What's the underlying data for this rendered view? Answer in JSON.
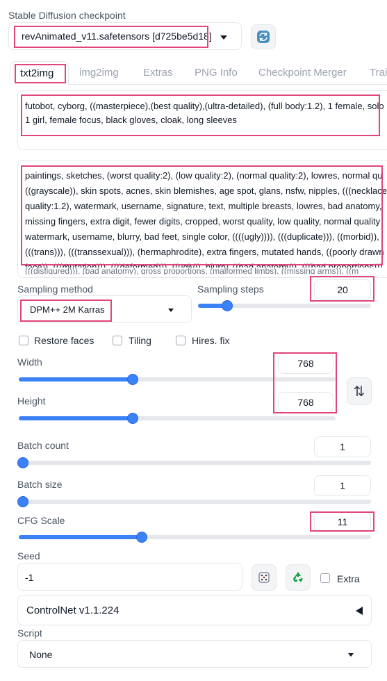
{
  "checkpoint": {
    "label": "Stable Diffusion checkpoint",
    "value": "revAnimated_v11.safetensors [d725be5d18]"
  },
  "tabs": [
    {
      "label": "txt2img",
      "active": true
    },
    {
      "label": "img2img"
    },
    {
      "label": "Extras"
    },
    {
      "label": "PNG Info"
    },
    {
      "label": "Checkpoint Merger"
    },
    {
      "label": "Trai"
    }
  ],
  "prompt": {
    "lines": [
      "futobot, cyborg, ((masterpiece),(best quality),(ultra-detailed), (full body:1.2), 1 female, solo",
      "1 girl, female focus, black gloves, cloak, long sleeves"
    ]
  },
  "negative_prompt": {
    "lines": [
      "paintings, sketches, (worst quality:2), (low quality:2), (normal quality:2), lowres, normal qu",
      "((grayscale)), skin spots, acnes, skin blemishes, age spot, glans, nsfw, nipples, (((necklace)",
      "quality:1.2), watermark, username, signature, text, multiple breasts, lowres, bad anatomy,",
      "missing fingers, extra digit, fewer digits, cropped, worst quality, low quality, normal quality",
      "watermark, username, blurry, bad feet, single color, ((((ugly)))), (((duplicate))), ((morbid)),",
      "(((trans))), (((transsexual))), (hermaphrodite), extra fingers, mutated hands, ((poorly drawn",
      "face)), (((mutation))), (((deformed))), ((ugly)), blurry, ((bad anatomy)), (((bad proportions)))",
      "(((disfigured))), (bad anatomy), gross proportions, (malformed limbs), ((missing arms)), ((m"
    ]
  },
  "sampling_method": {
    "label": "Sampling method",
    "value": "DPM++ 2M Karras"
  },
  "sampling_steps": {
    "label": "Sampling steps",
    "value": "20",
    "fraction": 0.17
  },
  "options": {
    "restore_faces": "Restore faces",
    "tiling": "Tiling",
    "hires_fix": "Hires. fix"
  },
  "width": {
    "label": "Width",
    "value": "768",
    "fraction": 0.36
  },
  "height": {
    "label": "Height",
    "value": "768",
    "fraction": 0.36
  },
  "swap_icon": "⇅",
  "batch_count": {
    "label": "Batch count",
    "value": "1",
    "fraction": 0.0
  },
  "batch_size": {
    "label": "Batch size",
    "value": "1",
    "fraction": 0.0
  },
  "cfg_scale": {
    "label": "CFG Scale",
    "value": "11",
    "fraction": 0.35
  },
  "seed": {
    "label": "Seed",
    "value": "-1",
    "extra_label": "Extra"
  },
  "controlnet": {
    "label": "ControlNet v1.1.224"
  },
  "script": {
    "label": "Script",
    "value": "None"
  },
  "colors": {
    "accent": "#3b82f6",
    "highlight": "#e0457b",
    "recycle": "#16a34a"
  }
}
